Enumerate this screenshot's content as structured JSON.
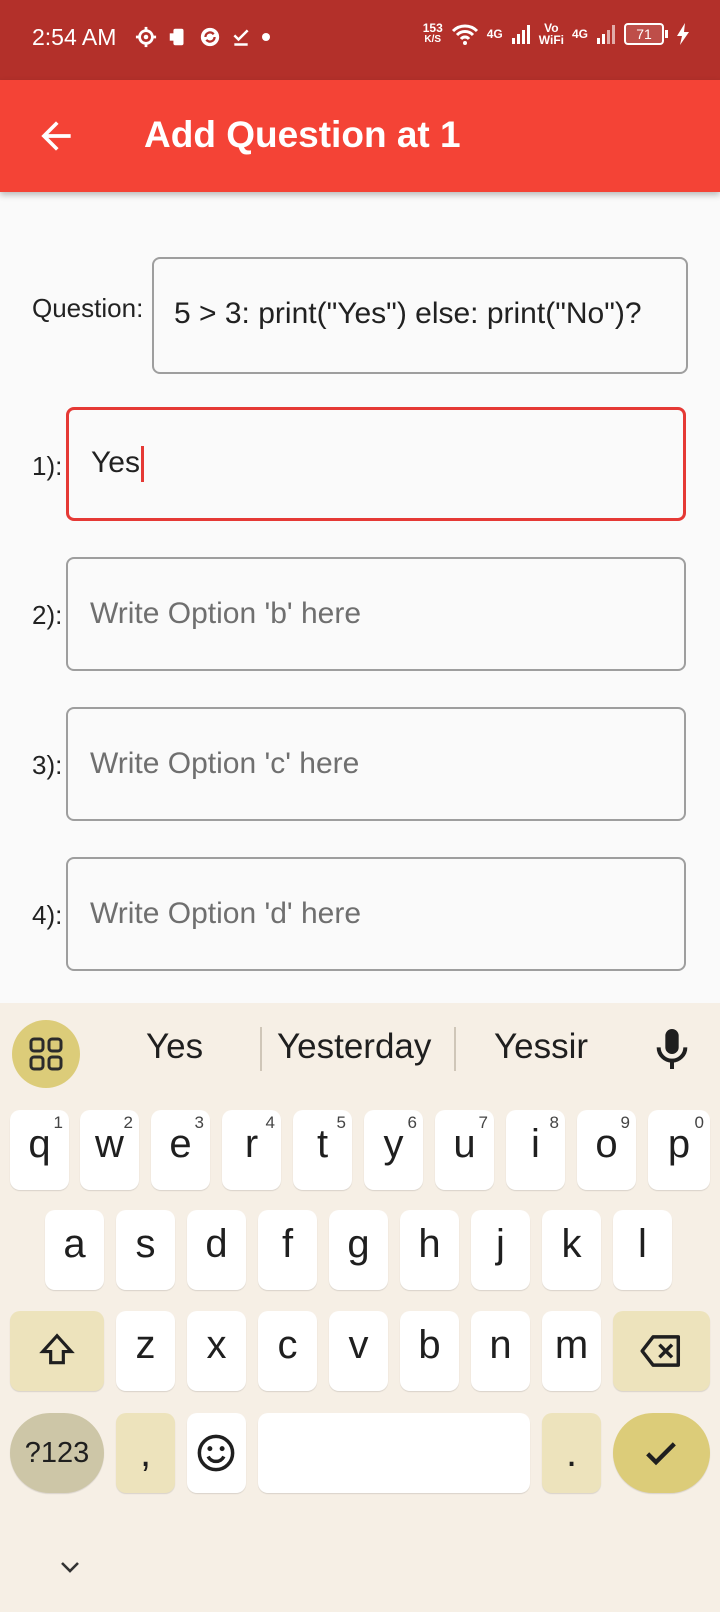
{
  "status_bar": {
    "time": "2:54 AM",
    "net_speed_value": "153",
    "net_speed_unit": "K/S",
    "network_1": "4G",
    "vowifi_top": "Vo",
    "vowifi_bottom": "WiFi",
    "network_2": "4G",
    "battery": "71"
  },
  "app_bar": {
    "title": "Add Question at 1"
  },
  "form": {
    "question_label": "Question:",
    "question_value": "5 > 3: print(\"Yes\") else: print(\"No\")?",
    "options": [
      {
        "label": "1):",
        "value": "Yes",
        "placeholder": ""
      },
      {
        "label": "2):",
        "value": "",
        "placeholder": "Write Option 'b' here"
      },
      {
        "label": "3):",
        "value": "",
        "placeholder": "Write Option 'c' here"
      },
      {
        "label": "4):",
        "value": "",
        "placeholder": "Write Option 'd' here"
      }
    ]
  },
  "keyboard": {
    "suggestions": [
      "Yes",
      "Yesterday",
      "Yessir"
    ],
    "row1": [
      {
        "ch": "q",
        "hint": "1"
      },
      {
        "ch": "w",
        "hint": "2"
      },
      {
        "ch": "e",
        "hint": "3"
      },
      {
        "ch": "r",
        "hint": "4"
      },
      {
        "ch": "t",
        "hint": "5"
      },
      {
        "ch": "y",
        "hint": "6"
      },
      {
        "ch": "u",
        "hint": "7"
      },
      {
        "ch": "i",
        "hint": "8"
      },
      {
        "ch": "o",
        "hint": "9"
      },
      {
        "ch": "p",
        "hint": "0"
      }
    ],
    "row2": [
      "a",
      "s",
      "d",
      "f",
      "g",
      "h",
      "j",
      "k",
      "l"
    ],
    "row3": [
      "z",
      "x",
      "c",
      "v",
      "b",
      "n",
      "m"
    ],
    "symbols_label": "?123",
    "comma": ",",
    "period": "."
  },
  "colors": {
    "status_bar": "#b3302a",
    "app_bar": "#f44336",
    "focus_border": "#e53935",
    "keyboard_bg": "#f6efe5",
    "accent_key": "#dccc79"
  },
  "icons": {
    "back": "arrow-back-icon",
    "apps": "grid-icon",
    "mic": "mic-icon",
    "shift": "shift-icon",
    "backspace": "backspace-icon",
    "emoji": "emoji-icon",
    "enter": "check-icon",
    "collapse": "chevron-down-icon"
  }
}
